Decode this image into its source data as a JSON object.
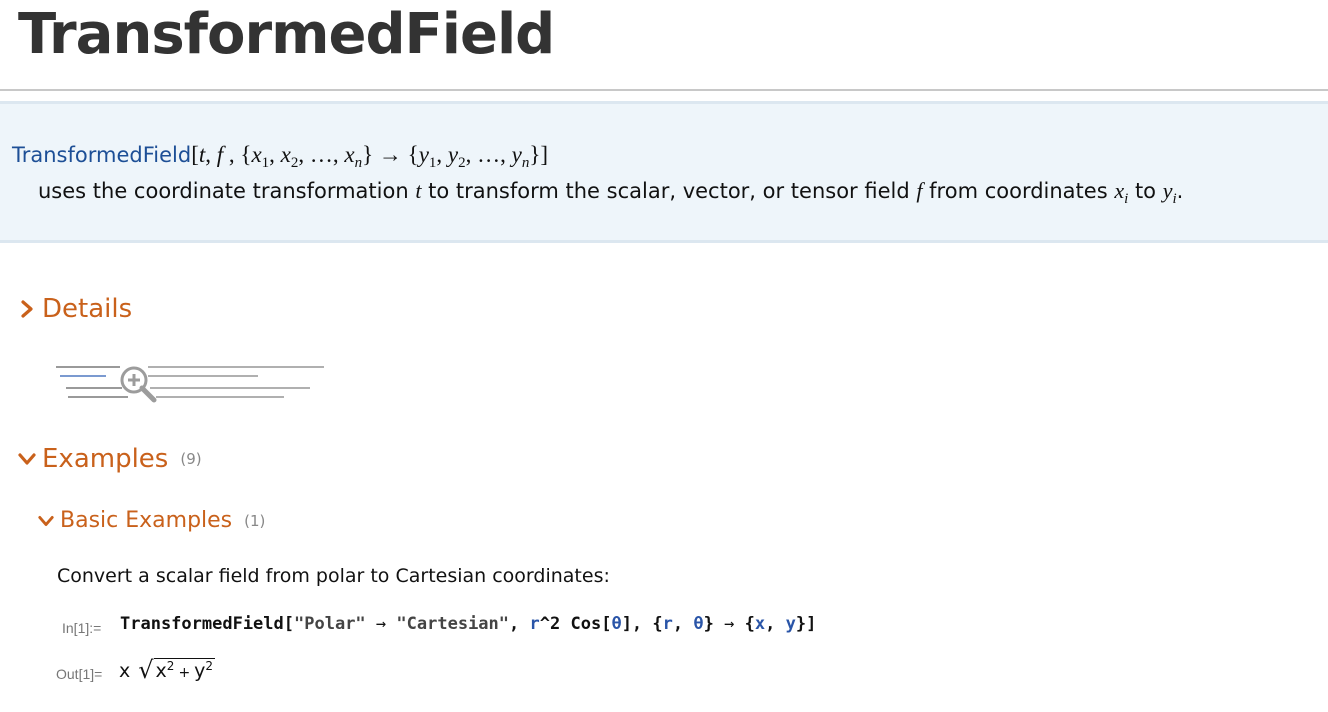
{
  "page": {
    "title": "TransformedField"
  },
  "usage": {
    "function_name": "TransformedField",
    "description": "uses the coordinate transformation t to transform the scalar, vector, or tensor field f from coordinates xi to yi."
  },
  "sections": {
    "details": {
      "label": "Details",
      "icon": "chevron-right-icon"
    },
    "details_thumbnail": {
      "icon": "zoom-in-icon"
    },
    "examples": {
      "label": "Examples",
      "count": "(9)",
      "icon": "chevron-down-icon"
    },
    "basic_examples": {
      "label": "Basic Examples",
      "count": "(1)",
      "icon": "chevron-down-icon"
    }
  },
  "example": {
    "caption": "Convert a scalar field from polar to Cartesian coordinates:",
    "in_label": "In[1]:=",
    "out_label": "Out[1]=",
    "input_code": "TransformedField[\"Polar\" → \"Cartesian\", r^2 Cos[θ], {r, θ} → {x, y}]",
    "output_expr": "x √(x² + y²)"
  },
  "colors": {
    "section_heading": "#c9611b",
    "function_link": "#1d4f96",
    "usage_background": "#eef5fa",
    "variable": "#2a55a8",
    "cell_label": "#777777"
  }
}
